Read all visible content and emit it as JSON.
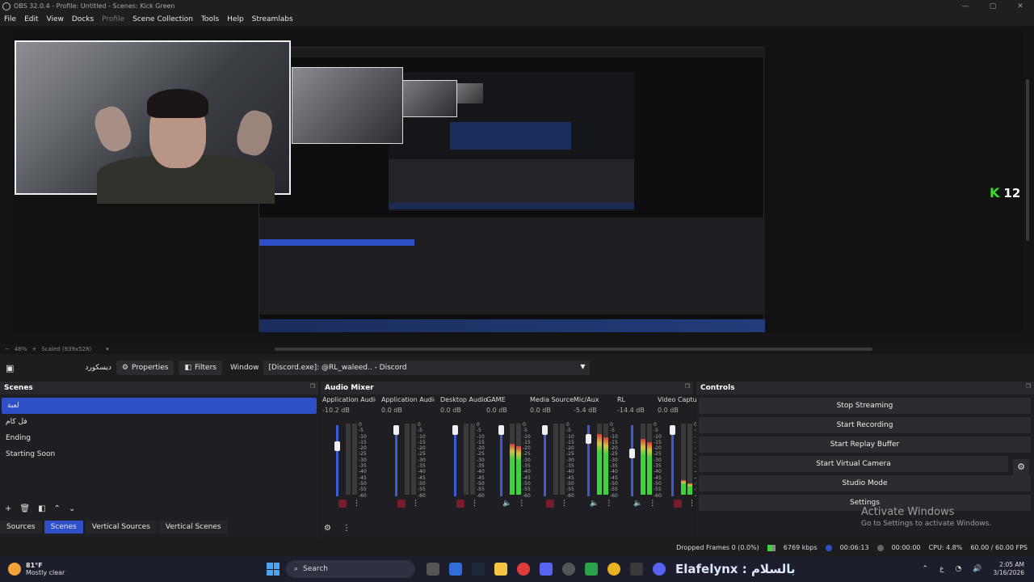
{
  "titlebar": {
    "title": "OBS 32.0.4 - Profile: Untitled - Scenes: Kick Green",
    "min": "—",
    "max": "▢",
    "close": "✕"
  },
  "menu": [
    "File",
    "Edit",
    "View",
    "Docks",
    "Profile",
    "Scene Collection",
    "Tools",
    "Help",
    "Streamlabs"
  ],
  "preview": {
    "overlay_label": "12"
  },
  "zoombar": {
    "minus": "−",
    "zoom": "48%",
    "plus": "+",
    "scaled": "Scaled (939x528)",
    "arrow": "▾"
  },
  "toolbar": {
    "source_name": "ديسكورد",
    "properties": "Properties",
    "filters": "Filters",
    "window_label": "Window",
    "window_value": "[Discord.exe]: @RL_waleed.. - Discord"
  },
  "scenes": {
    "title": "Scenes",
    "items": [
      "لعبة",
      "فل كام",
      "Ending",
      "Starting Soon"
    ],
    "selected_index": 0
  },
  "dock_tabs": [
    "Sources",
    "Scenes",
    "Vertical Sources",
    "Vertical Scenes"
  ],
  "mixer": {
    "title": "Audio Mixer",
    "scale": [
      "0",
      "-5",
      "-10",
      "-15",
      "-20",
      "-25",
      "-30",
      "-35",
      "-40",
      "-45",
      "-50",
      "-55",
      "-60"
    ],
    "channels": [
      {
        "name": "Application Audio Capture",
        "db": "-10.2 dB",
        "muted": true,
        "level": 0
      },
      {
        "name": "Application Audio Capture",
        "db": "0.0 dB",
        "muted": true,
        "level": 0
      },
      {
        "name": "Desktop Audio",
        "db": "0.0 dB",
        "muted": true,
        "level": 0
      },
      {
        "name": "GAME",
        "db": "0.0 dB",
        "muted": false,
        "level": 0.72
      },
      {
        "name": "Media Source",
        "db": "0.0 dB",
        "muted": true,
        "level": 0
      },
      {
        "name": "Mic/Aux",
        "db": "-5.4 dB",
        "muted": false,
        "level": 0.85
      },
      {
        "name": "RL",
        "db": "-14.4 dB",
        "muted": false,
        "level": 0.78
      },
      {
        "name": "Video Capture Device",
        "db": "0.0 dB",
        "muted": true,
        "level": 0.2
      }
    ]
  },
  "controls": {
    "title": "Controls",
    "buttons": [
      "Stop Streaming",
      "Start Recording",
      "Start Replay Buffer",
      "Start Virtual Camera",
      "Studio Mode",
      "Settings"
    ]
  },
  "activate": {
    "line1": "Activate Windows",
    "line2": "Go to Settings to activate Windows."
  },
  "status": {
    "dropped": "Dropped Frames 0 (0.0%)",
    "kbps": "6769 kbps",
    "stream_time": "00:06:13",
    "rec_time": "00:00:00",
    "cpu": "CPU: 4.8%",
    "fps": "60.00 / 60.00 FPS"
  },
  "taskbar": {
    "temp": "81°F",
    "weather": "Mostly clear",
    "search": "Search",
    "elaf": "Elafelynx : بالسلام",
    "time": "2:05 AM",
    "date": "3/16/2026",
    "lang": "ع"
  },
  "colors": {
    "accent": "#2e4fc8",
    "green": "#38e02a",
    "mute": "#7a1d2a"
  }
}
